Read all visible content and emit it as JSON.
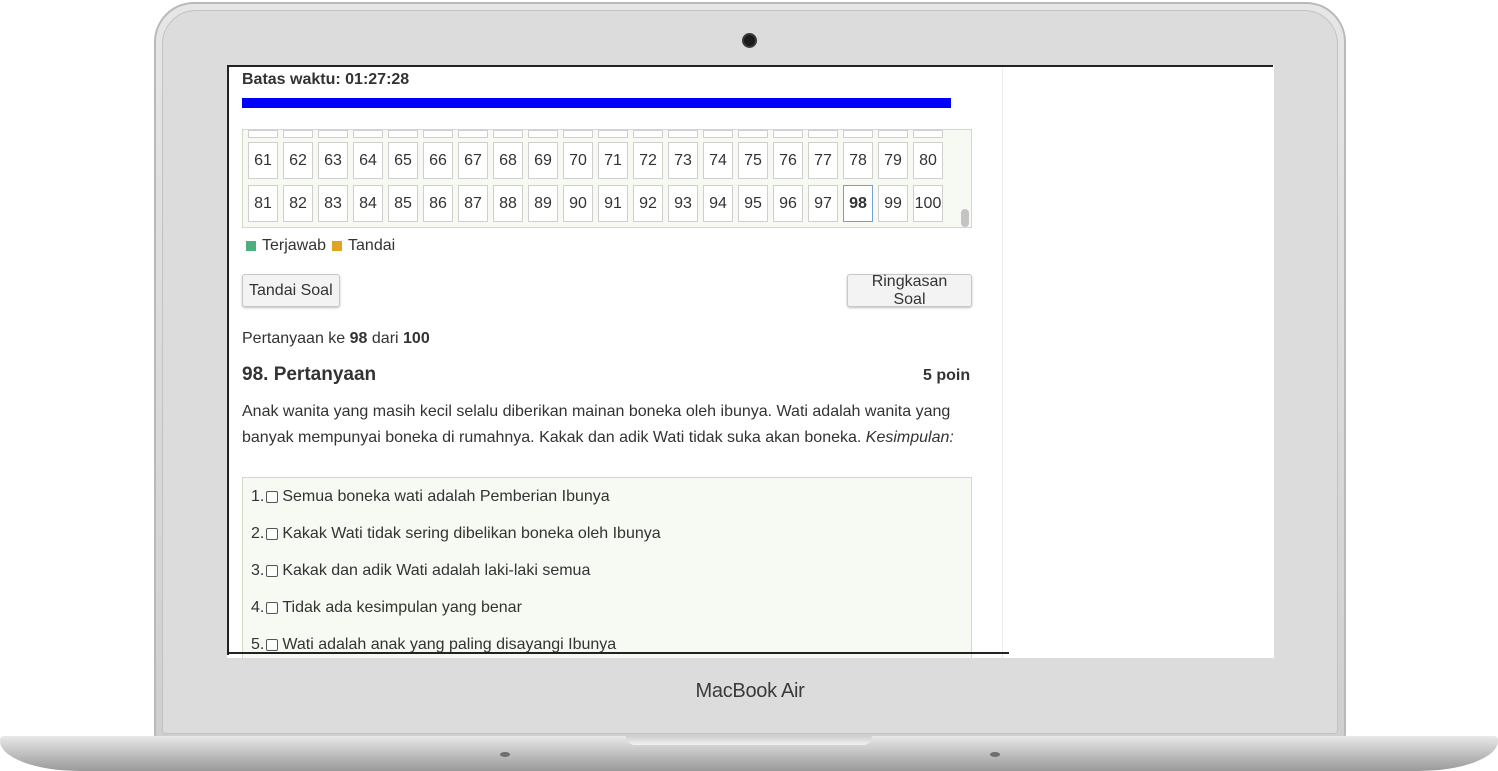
{
  "device": {
    "brand": "MacBook Air"
  },
  "quiz": {
    "timer_label": "Batas waktu: 01:27:28",
    "progress_percent": 100,
    "progress_color": "#0000ff",
    "nav_rows": [
      [
        "61",
        "62",
        "63",
        "64",
        "65",
        "66",
        "67",
        "68",
        "69",
        "70",
        "71",
        "72",
        "73",
        "74",
        "75",
        "76",
        "77",
        "78",
        "79",
        "80"
      ],
      [
        "81",
        "82",
        "83",
        "84",
        "85",
        "86",
        "87",
        "88",
        "89",
        "90",
        "91",
        "92",
        "93",
        "94",
        "95",
        "96",
        "97",
        "98",
        "99",
        "100"
      ]
    ],
    "current_question": "98",
    "legend": {
      "answered_label": "Terjawab",
      "answered_color": "#4caf7d",
      "flagged_label": "Tandai",
      "flagged_color": "#e0a422"
    },
    "buttons": {
      "mark_label": "Tandai Soal",
      "summary_label": "Ringkasan Soal"
    },
    "count": {
      "prefix": "Pertanyaan ke",
      "current": "98",
      "middle": "dari",
      "total": "100"
    },
    "question": {
      "title": "98. Pertanyaan",
      "points": "5 poin",
      "text": "Anak wanita yang masih kecil selalu diberikan mainan boneka oleh ibunya. Wati adalah wanita yang banyak mempunyai boneka di rumahnya. Kakak dan adik Wati tidak suka akan boneka.",
      "conclusion_label": "Kesimpulan:"
    },
    "options": [
      {
        "num": "1.",
        "text": "Semua boneka wati adalah Pemberian Ibunya"
      },
      {
        "num": "2.",
        "text": "Kakak Wati tidak sering dibelikan boneka oleh Ibunya"
      },
      {
        "num": "3.",
        "text": "Kakak dan adik Wati adalah laki-laki semua"
      },
      {
        "num": "4.",
        "text": "Tidak ada kesimpulan yang benar"
      },
      {
        "num": "5.",
        "text": "Wati adalah anak yang paling disayangi Ibunya"
      }
    ]
  }
}
